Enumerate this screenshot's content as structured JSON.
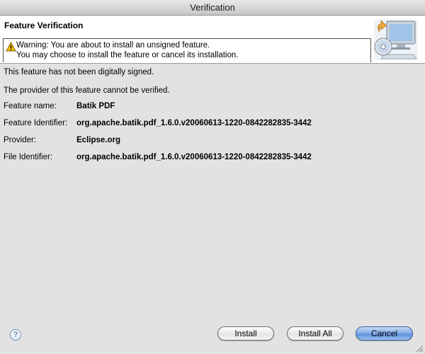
{
  "window": {
    "title": "Verification"
  },
  "banner": {
    "title": "Feature Verification",
    "warning_line1": "Warning: You are about to install an unsigned feature.",
    "warning_line2": "You may choose to install the feature or cancel its installation."
  },
  "body": {
    "not_signed": "This feature has not been digitally signed.",
    "provider_unverified": "The provider of this feature cannot be verified.",
    "fields": [
      {
        "label": "Feature name:",
        "value": "Batik PDF"
      },
      {
        "label": "Feature Identifier:",
        "value": "org.apache.batik.pdf_1.6.0.v20060613-1220-0842282835-3442"
      },
      {
        "label": "Provider:",
        "value": "Eclipse.org"
      },
      {
        "label": "File Identifier:",
        "value": "org.apache.batik.pdf_1.6.0.v20060613-1220-0842282835-3442"
      }
    ]
  },
  "footer": {
    "help_glyph": "?",
    "install_label": "Install",
    "install_all_label": "Install All",
    "cancel_label": "Cancel"
  },
  "icons": {
    "warning": "warning-icon",
    "banner": "install-computer-cd-icon",
    "help": "help-icon"
  },
  "colors": {
    "dialog_background": "#e2e2e2",
    "banner_background": "#ffffff",
    "default_button": "#5d8fdd",
    "warning_yellow": "#f2c200"
  }
}
